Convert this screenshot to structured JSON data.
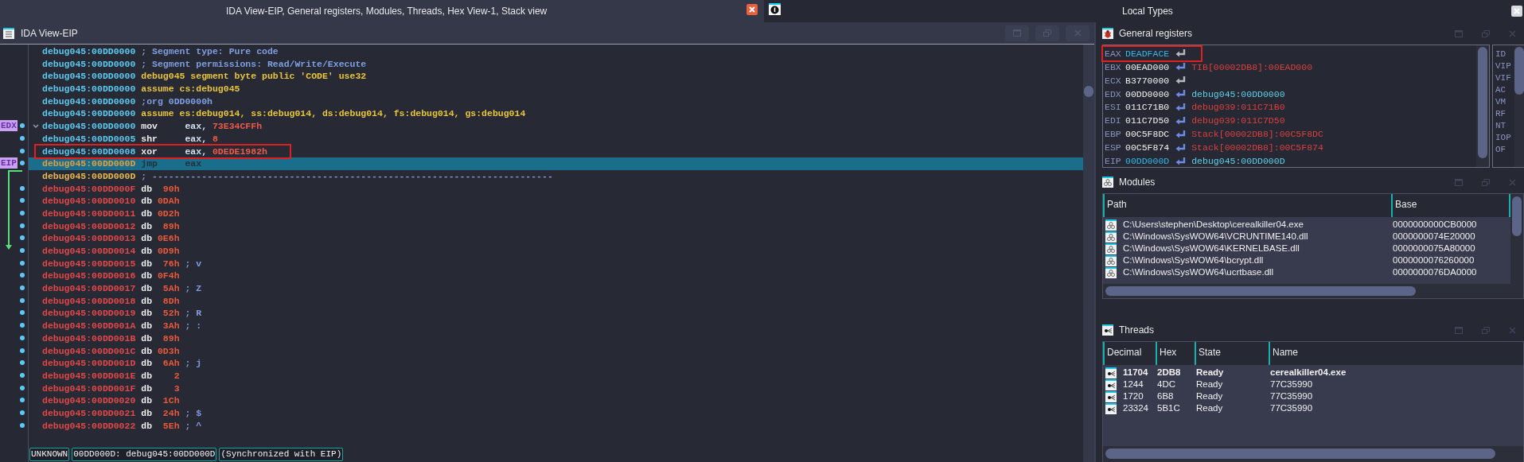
{
  "window": {
    "title": "IDA View-EIP, General registers, Modules, Threads, Hex View-1, Stack view"
  },
  "side_tab": {
    "title": "Local Types"
  },
  "disassembly": {
    "title": "IDA View-EIP",
    "lines": [
      {
        "address": "debug045:00DD0000",
        "kind": "comment",
        "text": "; Segment type: Pure code"
      },
      {
        "address": "debug045:00DD0000",
        "kind": "comment",
        "text": "; Segment permissions: Read/Write/Execute"
      },
      {
        "address": "debug045:00DD0000",
        "kind": "directive",
        "text": "debug045 segment byte public 'CODE' use32"
      },
      {
        "address": "debug045:00DD0000",
        "kind": "directive",
        "text": "assume cs:debug045"
      },
      {
        "address": "debug045:00DD0000",
        "kind": "comment",
        "text": ";org 0DD0000h"
      },
      {
        "address": "debug045:00DD0000",
        "kind": "directive",
        "text": "assume es:debug014, ss:debug014, ds:debug014, fs:debug014, gs:debug014"
      },
      {
        "address": "debug045:00DD0000",
        "kind": "instruction",
        "mnemonic": "mov",
        "operand": "eax,",
        "value": "73E34CFFh",
        "marker": "EDX",
        "fold_toggle": true,
        "current": false,
        "boxed": false
      },
      {
        "address": "debug045:00DD0005",
        "kind": "instruction",
        "mnemonic": "shr",
        "operand": "eax,",
        "value": "8",
        "current": false,
        "boxed": false
      },
      {
        "address": "debug045:00DD0008",
        "kind": "instruction",
        "mnemonic": "xor",
        "operand": "eax,",
        "value": "0DEDE1982h",
        "current": false,
        "boxed": true
      },
      {
        "address": "debug045:00DD000D",
        "kind": "instruction",
        "mnemonic": "jmp",
        "operand": "eax",
        "marker": "EIP",
        "current": true,
        "boxed": false
      },
      {
        "address": "debug045:00DD000D",
        "kind": "separator",
        "text": "; -------------------------------------------------------------------------"
      },
      {
        "address": "debug045:00DD000F",
        "kind": "data",
        "mnemonic": "db",
        "value": "90h"
      },
      {
        "address": "debug045:00DD0010",
        "kind": "data",
        "mnemonic": "db",
        "value": "0DAh"
      },
      {
        "address": "debug045:00DD0011",
        "kind": "data",
        "mnemonic": "db",
        "value": "0D2h"
      },
      {
        "address": "debug045:00DD0012",
        "kind": "data",
        "mnemonic": "db",
        "value": "89h"
      },
      {
        "address": "debug045:00DD0013",
        "kind": "data",
        "mnemonic": "db",
        "value": "0E6h"
      },
      {
        "address": "debug045:00DD0014",
        "kind": "data",
        "mnemonic": "db",
        "value": "0D9h"
      },
      {
        "address": "debug045:00DD0015",
        "kind": "data",
        "mnemonic": "db",
        "value": "76h",
        "comment": "; v"
      },
      {
        "address": "debug045:00DD0016",
        "kind": "data",
        "mnemonic": "db",
        "value": "0F4h"
      },
      {
        "address": "debug045:00DD0017",
        "kind": "data",
        "mnemonic": "db",
        "value": "5Ah",
        "comment": "; Z"
      },
      {
        "address": "debug045:00DD0018",
        "kind": "data",
        "mnemonic": "db",
        "value": "8Dh"
      },
      {
        "address": "debug045:00DD0019",
        "kind": "data",
        "mnemonic": "db",
        "value": "52h",
        "comment": "; R"
      },
      {
        "address": "debug045:00DD001A",
        "kind": "data",
        "mnemonic": "db",
        "value": "3Ah",
        "comment": "; :"
      },
      {
        "address": "debug045:00DD001B",
        "kind": "data",
        "mnemonic": "db",
        "value": "89h"
      },
      {
        "address": "debug045:00DD001C",
        "kind": "data",
        "mnemonic": "db",
        "value": "0D3h"
      },
      {
        "address": "debug045:00DD001D",
        "kind": "data",
        "mnemonic": "db",
        "value": "6Ah",
        "comment": "; j"
      },
      {
        "address": "debug045:00DD001E",
        "kind": "data",
        "mnemonic": "db",
        "value": "2"
      },
      {
        "address": "debug045:00DD001F",
        "kind": "data",
        "mnemonic": "db",
        "value": "3"
      },
      {
        "address": "debug045:00DD0020",
        "kind": "data",
        "mnemonic": "db",
        "value": "1Ch"
      },
      {
        "address": "debug045:00DD0021",
        "kind": "data",
        "mnemonic": "db",
        "value": "24h",
        "comment": "; $"
      },
      {
        "address": "debug045:00DD0022",
        "kind": "data",
        "mnemonic": "db",
        "value": "5Eh",
        "comment": "; ^"
      }
    ],
    "status": [
      "UNKNOWN",
      "00DD000D: debug045:00DD000D",
      "(Synchronized with EIP)"
    ]
  },
  "registers": {
    "title": "General registers",
    "rows": [
      {
        "name": "EAX",
        "value": "DEADFACE",
        "changed": true,
        "boxed": true
      },
      {
        "name": "EBX",
        "value": "00EAD000",
        "changed": false,
        "boxed": false,
        "ref": "TIB[00002DB8]:00EAD000",
        "color": "#d84040"
      },
      {
        "name": "ECX",
        "value": "B3770000",
        "changed": false,
        "boxed": false
      },
      {
        "name": "EDX",
        "value": "00DD0000",
        "changed": false,
        "boxed": false,
        "ref": "debug045:00DD0000",
        "color": "#5fd0e8"
      },
      {
        "name": "ESI",
        "value": "011C71B0",
        "changed": false,
        "boxed": false,
        "ref": "debug039:011C71B0",
        "color": "#d84040"
      },
      {
        "name": "EDI",
        "value": "011C7D50",
        "changed": false,
        "boxed": false,
        "ref": "debug039:011C7D50",
        "color": "#d84040"
      },
      {
        "name": "EBP",
        "value": "00C5F8DC",
        "changed": false,
        "boxed": false,
        "ref": "Stack[00002DB8]:00C5F8DC",
        "color": "#d84040"
      },
      {
        "name": "ESP",
        "value": "00C5F874",
        "changed": false,
        "boxed": false,
        "ref": "Stack[00002DB8]:00C5F874",
        "color": "#d84040"
      },
      {
        "name": "EIP",
        "value": "00DD000D",
        "changed": true,
        "boxed": false,
        "ref": "debug045:00DD000D",
        "color": "#5fd0e8"
      }
    ],
    "flags": [
      "ID",
      "VIP",
      "VIF",
      "AC",
      "VM",
      "RF",
      "NT",
      "IOP",
      "OF"
    ]
  },
  "modules": {
    "title": "Modules",
    "columns": [
      "Path",
      "Base"
    ],
    "rows": [
      {
        "path": "C:\\Users\\stephen\\Desktop\\cerealkiller04.exe",
        "base": "0000000000CB0000"
      },
      {
        "path": "C:\\Windows\\SysWOW64\\VCRUNTIME140.dll",
        "base": "0000000074E20000"
      },
      {
        "path": "C:\\Windows\\SysWOW64\\KERNELBASE.dll",
        "base": "0000000075A80000"
      },
      {
        "path": "C:\\Windows\\SysWOW64\\bcrypt.dll",
        "base": "0000000076260000"
      },
      {
        "path": "C:\\Windows\\SysWOW64\\ucrtbase.dll",
        "base": "0000000076DA0000"
      }
    ]
  },
  "threads": {
    "title": "Threads",
    "columns": [
      "Decimal",
      "Hex",
      "State",
      "Name"
    ],
    "rows": [
      {
        "decimal": "11704",
        "hex": "2DB8",
        "state": "Ready",
        "name": "cerealkiller04.exe",
        "current": true
      },
      {
        "decimal": "1244",
        "hex": "4DC",
        "state": "Ready",
        "name": "77C35990",
        "current": false
      },
      {
        "decimal": "1720",
        "hex": "6B8",
        "state": "Ready",
        "name": "77C35990",
        "current": false
      },
      {
        "decimal": "23324",
        "hex": "5B1C",
        "state": "Ready",
        "name": "77C35990",
        "current": false
      }
    ]
  }
}
